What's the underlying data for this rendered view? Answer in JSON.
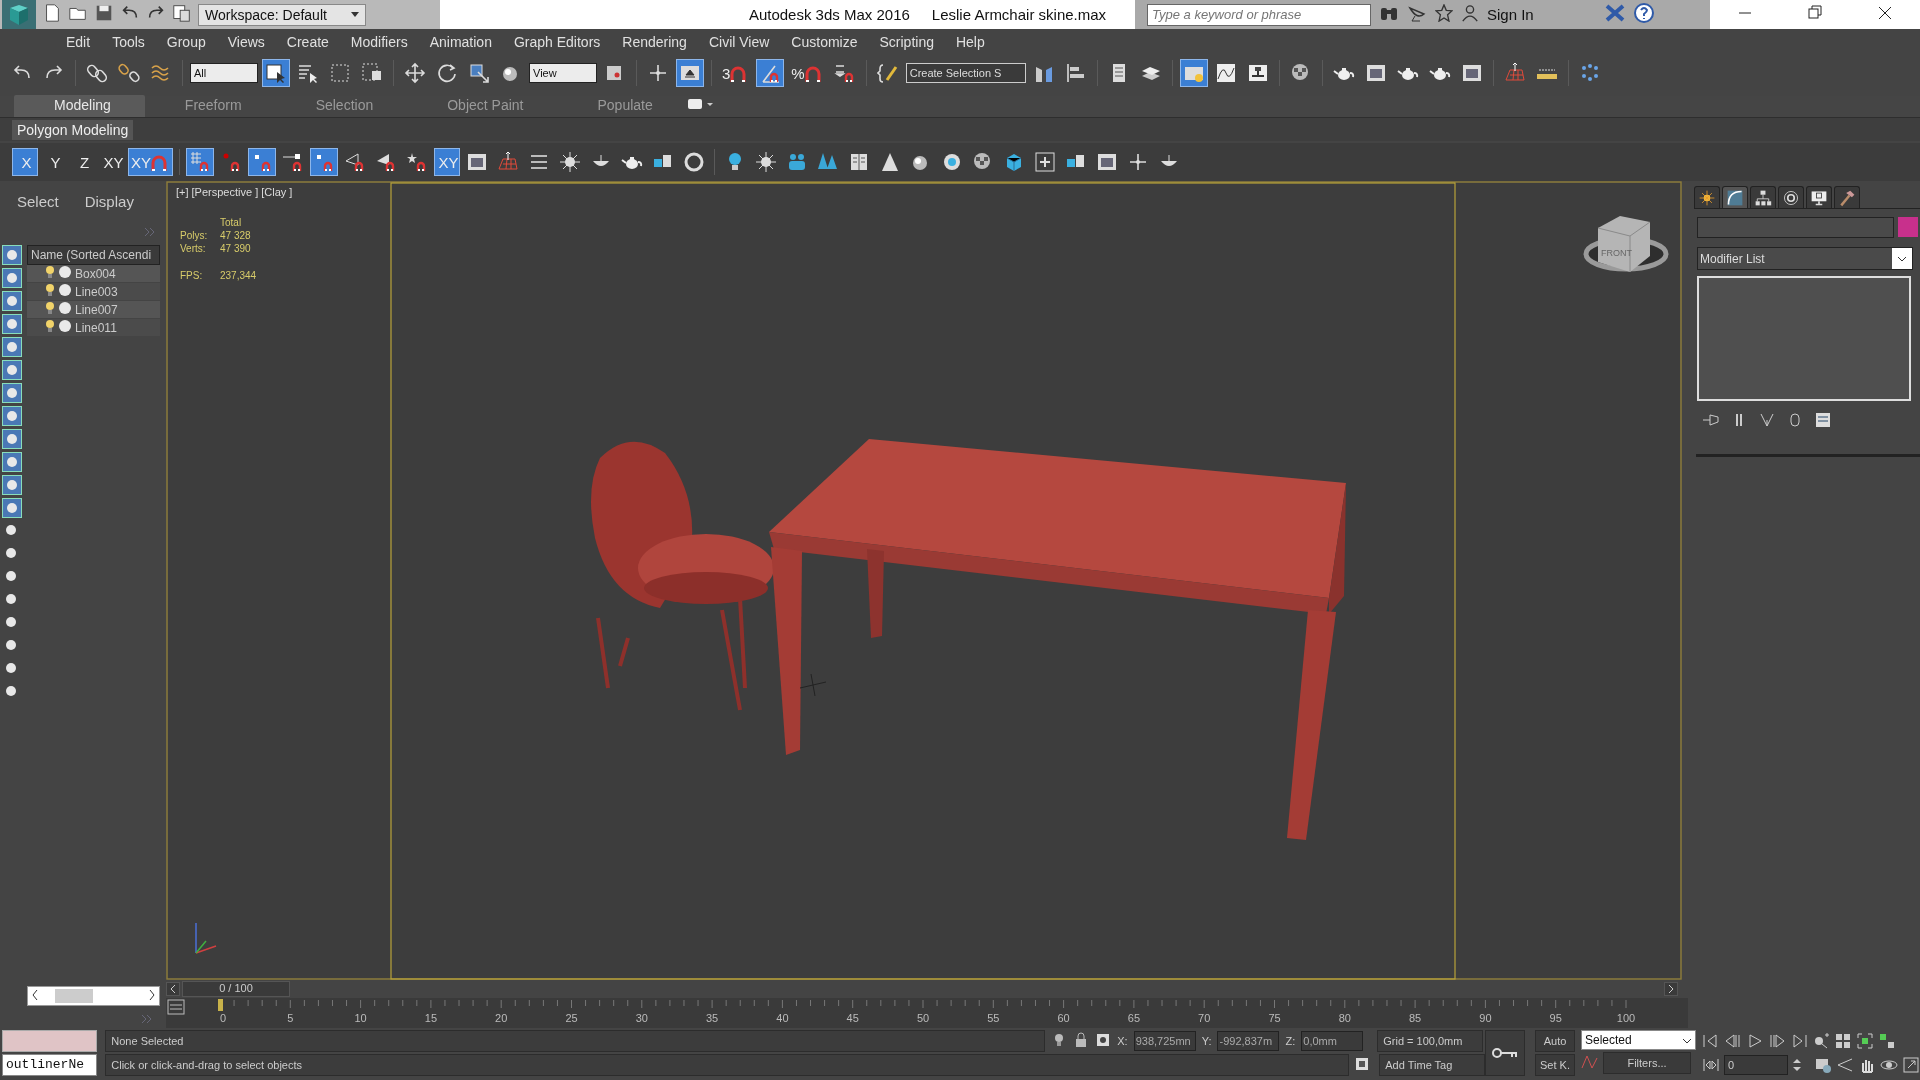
{
  "title_bar": {
    "workspace": "Workspace: Default",
    "title": "Autodesk 3ds Max 2016",
    "file": "Leslie Armchair skine.max",
    "search_placeholder": "Type a keyword or phrase",
    "sign_in": "Sign In"
  },
  "menu": [
    "Edit",
    "Tools",
    "Group",
    "Views",
    "Create",
    "Modifiers",
    "Animation",
    "Graph Editors",
    "Rendering",
    "Civil View",
    "Customize",
    "Scripting",
    "Help"
  ],
  "main_toolbar": [
    {
      "kind": "button",
      "on": false
    },
    {
      "kind": "button",
      "on": false
    },
    {
      "kind": "separator"
    },
    {
      "kind": "button",
      "on": false
    },
    {
      "kind": "button",
      "on": false
    },
    {
      "kind": "button",
      "on": false
    },
    {
      "kind": "separator"
    },
    {
      "kind": "dropdown",
      "value": "All"
    },
    {
      "kind": "button",
      "on": true
    },
    {
      "kind": "button",
      "on": false
    },
    {
      "kind": "button",
      "on": false
    },
    {
      "kind": "button",
      "on": false
    },
    {
      "kind": "separator"
    },
    {
      "kind": "button",
      "on": false
    },
    {
      "kind": "button",
      "on": false
    },
    {
      "kind": "button",
      "on": false
    },
    {
      "kind": "button",
      "on": false
    },
    {
      "kind": "dropdown",
      "value": "View"
    },
    {
      "kind": "button",
      "on": false
    },
    {
      "kind": "separator"
    },
    {
      "kind": "button",
      "on": false
    },
    {
      "kind": "button",
      "on": true
    },
    {
      "kind": "separator"
    },
    {
      "kind": "button",
      "on": false,
      "label": "3"
    },
    {
      "kind": "button",
      "on": true
    },
    {
      "kind": "button",
      "on": false,
      "label": "%"
    },
    {
      "kind": "button",
      "on": false
    },
    {
      "kind": "separator"
    },
    {
      "kind": "button",
      "on": false
    },
    {
      "kind": "dropdown",
      "value": "Create Selection S"
    },
    {
      "kind": "button",
      "on": false
    },
    {
      "kind": "button",
      "on": false
    },
    {
      "kind": "separator"
    },
    {
      "kind": "button",
      "on": false
    },
    {
      "kind": "button",
      "on": false
    },
    {
      "kind": "separator"
    },
    {
      "kind": "button",
      "on": true
    },
    {
      "kind": "button",
      "on": false
    },
    {
      "kind": "button",
      "on": false
    },
    {
      "kind": "separator"
    },
    {
      "kind": "button",
      "on": false
    },
    {
      "kind": "separator"
    },
    {
      "kind": "button",
      "on": false
    },
    {
      "kind": "button",
      "on": false
    },
    {
      "kind": "button",
      "on": false
    },
    {
      "kind": "button",
      "on": false
    },
    {
      "kind": "button",
      "on": false
    },
    {
      "kind": "separator"
    },
    {
      "kind": "button",
      "on": false
    },
    {
      "kind": "button",
      "on": false
    },
    {
      "kind": "separator"
    },
    {
      "kind": "button",
      "on": false
    }
  ],
  "ribbon_tabs": [
    {
      "label": "Modeling",
      "selected": true
    },
    {
      "label": "Freeform",
      "selected": false
    },
    {
      "label": "Selection",
      "selected": false
    },
    {
      "label": "Object Paint",
      "selected": false
    },
    {
      "label": "Populate",
      "selected": false
    }
  ],
  "ribbon_panel": "Polygon Modeling",
  "ribbon_toolbar": [
    {
      "kind": "button",
      "on": true,
      "label": "X"
    },
    {
      "kind": "button",
      "on": false,
      "label": "Y"
    },
    {
      "kind": "button",
      "on": false,
      "label": "Z"
    },
    {
      "kind": "button",
      "on": false,
      "label": "XY"
    },
    {
      "kind": "button",
      "on": true,
      "label": "XY"
    },
    {
      "kind": "separator"
    },
    {
      "kind": "button",
      "on": true
    },
    {
      "kind": "button",
      "on": false
    },
    {
      "kind": "button",
      "on": true
    },
    {
      "kind": "button",
      "on": false
    },
    {
      "kind": "button",
      "on": true
    },
    {
      "kind": "button",
      "on": false
    },
    {
      "kind": "button",
      "on": false
    },
    {
      "kind": "button",
      "on": false
    },
    {
      "kind": "button",
      "on": true,
      "label": "XY"
    },
    {
      "kind": "button",
      "on": false
    },
    {
      "kind": "button",
      "on": false
    },
    {
      "kind": "button",
      "on": false
    },
    {
      "kind": "button",
      "on": false
    },
    {
      "kind": "button",
      "on": false
    },
    {
      "kind": "button",
      "on": false
    },
    {
      "kind": "button",
      "on": false
    },
    {
      "kind": "button",
      "on": false
    },
    {
      "kind": "separator"
    },
    {
      "kind": "button",
      "on": false
    },
    {
      "kind": "button",
      "on": false
    },
    {
      "kind": "button",
      "on": false
    },
    {
      "kind": "button",
      "on": false
    },
    {
      "kind": "button",
      "on": false
    },
    {
      "kind": "button",
      "on": false
    },
    {
      "kind": "button",
      "on": false
    },
    {
      "kind": "button",
      "on": false
    },
    {
      "kind": "button",
      "on": false
    },
    {
      "kind": "button",
      "on": false
    },
    {
      "kind": "button",
      "on": false
    },
    {
      "kind": "button",
      "on": false
    },
    {
      "kind": "button",
      "on": false
    },
    {
      "kind": "button",
      "on": false
    },
    {
      "kind": "button",
      "on": false
    }
  ],
  "scene_explorer": {
    "tabs": [
      "Select",
      "Display"
    ],
    "header": "Name (Sorted Ascendi",
    "items": [
      "Box004",
      "Line003",
      "Line007",
      "Line011"
    ]
  },
  "viewport": {
    "labels": [
      "[+]",
      "[Perspective ]",
      "[Clay ]"
    ],
    "stats_header": "Total",
    "stats": [
      {
        "label": "Polys:",
        "value": "47 328"
      },
      {
        "label": "Verts:",
        "value": "47 390"
      }
    ],
    "fps": {
      "label": "FPS:",
      "value": "237,344"
    },
    "viewcube_label": "FRONT"
  },
  "command_panel": {
    "tabs": [
      {
        "selected": false
      },
      {
        "selected": true
      },
      {
        "selected": false
      },
      {
        "selected": false
      },
      {
        "selected": false
      },
      {
        "selected": false
      }
    ],
    "color": "#c8308c",
    "modifier_list": "Modifier List"
  },
  "time_slider": {
    "frame": "0 / 100",
    "level": 0,
    "ruler": [
      "0",
      "5",
      "10",
      "15",
      "20",
      "25",
      "30",
      "35",
      "40",
      "45",
      "50",
      "55",
      "60",
      "65",
      "70",
      "75",
      "80",
      "85",
      "90",
      "95",
      "100"
    ]
  },
  "status": {
    "maxscript": "outlinerNe",
    "selection": "None Selected",
    "prompt": "Click or click-and-drag to select objects",
    "coords": [
      {
        "label": "X:",
        "value": "938,725mn"
      },
      {
        "label": "Y:",
        "value": "-992,837m"
      },
      {
        "label": "Z:",
        "value": "0,0mm"
      }
    ],
    "grid": "Grid = 100,0mm",
    "add_time_tag": "Add Time Tag",
    "auto": "Auto",
    "set_key": "Set K.",
    "key_filter": "Selected",
    "filters": "Filters...",
    "frame": "0"
  }
}
